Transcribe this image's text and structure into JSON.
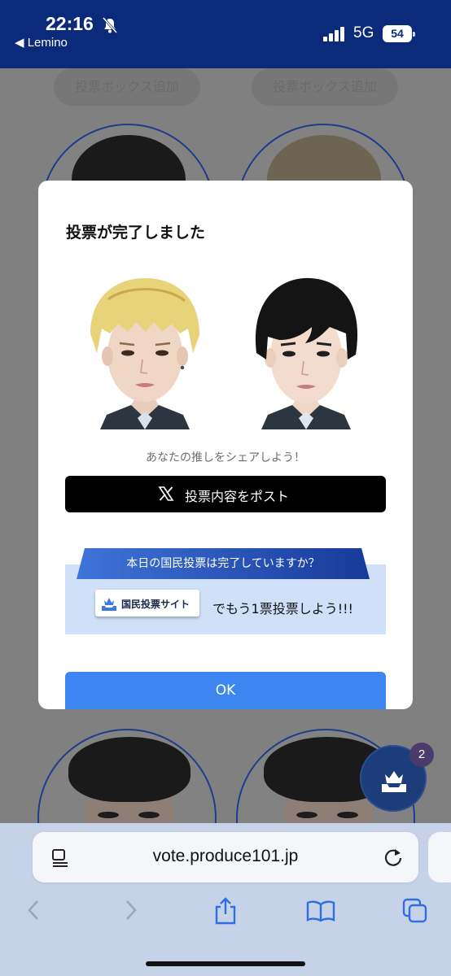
{
  "status_bar": {
    "time": "22:16",
    "back_app": "◀ Lemino",
    "network": "5G",
    "battery": "54"
  },
  "background": {
    "add_box_left": "投票ボックス追加",
    "add_box_right": "投票ボックス追加",
    "notification_count": "2"
  },
  "modal": {
    "title": "投票が完了しました",
    "share_prompt": "あなたの推しをシェアしよう！",
    "post_button": "投票内容をポスト",
    "promo_banner": "本日の国民投票は完了していますか？",
    "site_button": "国民投票サイト",
    "promo_tail": "でもう1票投票しよう!!!",
    "ok_button": "OK"
  },
  "browser": {
    "url": "vote.produce101.jp"
  },
  "colors": {
    "status_bar": "#0b2a7a",
    "ok_button": "#3d85f0",
    "promo_bg": "#cfe0f8",
    "ribbon": "#1e4fb5",
    "browser_bar": "#c6d2e8"
  }
}
